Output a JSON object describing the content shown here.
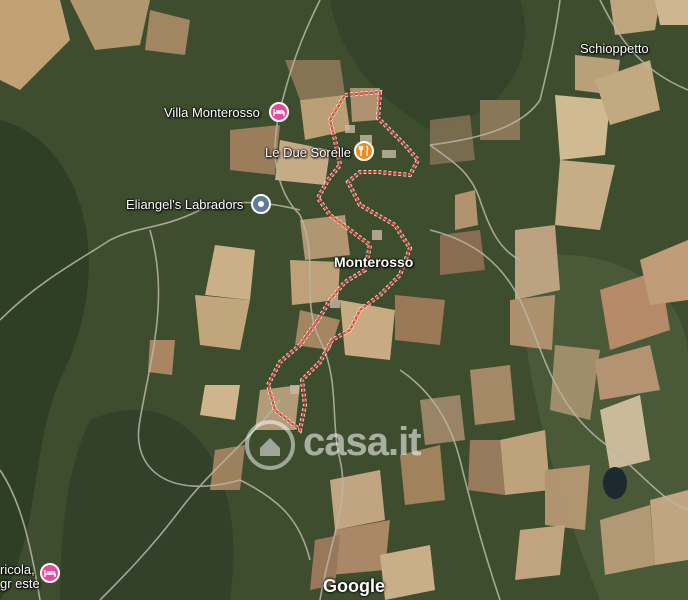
{
  "map": {
    "places": {
      "town": "Monterosso",
      "village": "Schioppetto",
      "hotel": "Villa Monterosso",
      "restaurant": "Le Due Sorelle",
      "business": "Eliangel's Labradors",
      "agri_line1": "ricola,",
      "agri_line2": "gr este"
    },
    "icons": {
      "hotel": "bed-icon",
      "restaurant": "fork-knife-icon",
      "business": "location-dot-icon",
      "agri": "bed-icon"
    },
    "colors": {
      "hotel_pin": "#e8499a",
      "restaurant_pin": "#f08a24",
      "business_pin": "#5f7c99",
      "boundary": "#e8453c"
    },
    "watermark": "casa.it",
    "attribution": "Google"
  }
}
